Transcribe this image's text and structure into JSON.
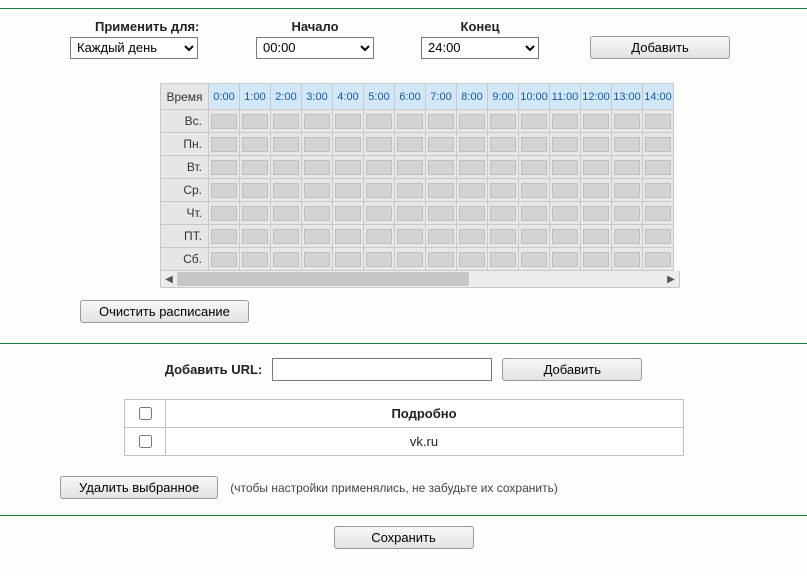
{
  "top": {
    "apply_label": "Применить для:",
    "start_label": "Начало",
    "end_label": "Конец",
    "apply_value": "Каждый день",
    "start_value": "00:00",
    "end_value": "24:00",
    "add_btn": "Добавить"
  },
  "schedule": {
    "time_header": "Время",
    "hours": [
      "0:00",
      "1:00",
      "2:00",
      "3:00",
      "4:00",
      "5:00",
      "6:00",
      "7:00",
      "8:00",
      "9:00",
      "10:00",
      "11:00",
      "12:00",
      "13:00",
      "14:00"
    ],
    "days": [
      "Вс.",
      "Пн.",
      "Вт.",
      "Ср.",
      "Чт.",
      "ПТ.",
      "Сб."
    ],
    "clear_btn": "Очистить расписание"
  },
  "urlsec": {
    "add_label": "Добавить URL:",
    "input_value": "",
    "add_btn": "Добавить",
    "header": "Подробно",
    "rows": [
      {
        "url": "vk.ru",
        "checked": false
      }
    ],
    "delete_btn": "Удалить выбранное",
    "hint": "(чтобы настройки применялись, не забудьте их сохранить)"
  },
  "save_btn": "Сохранить"
}
